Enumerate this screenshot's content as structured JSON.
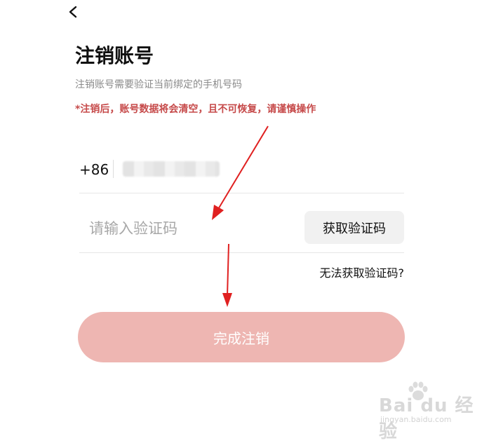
{
  "header": {
    "title": "注销账号",
    "subtitle": "注销账号需要验证当前绑定的手机号码",
    "warning": "*注销后，账号数据将会清空，且不可恢复，请谨慎操作"
  },
  "phone": {
    "country_code": "+86"
  },
  "code": {
    "placeholder": "请输入验证码",
    "get_code_label": "获取验证码"
  },
  "help_link": "无法获取验证码?",
  "submit_label": "完成注销",
  "watermark": {
    "main": "Bai du 经验",
    "sub": "jingyan.baidu.com"
  },
  "colors": {
    "warning": "#c64a4a",
    "submit_bg": "#eeb6b2",
    "annotation_arrow": "#e02020"
  }
}
